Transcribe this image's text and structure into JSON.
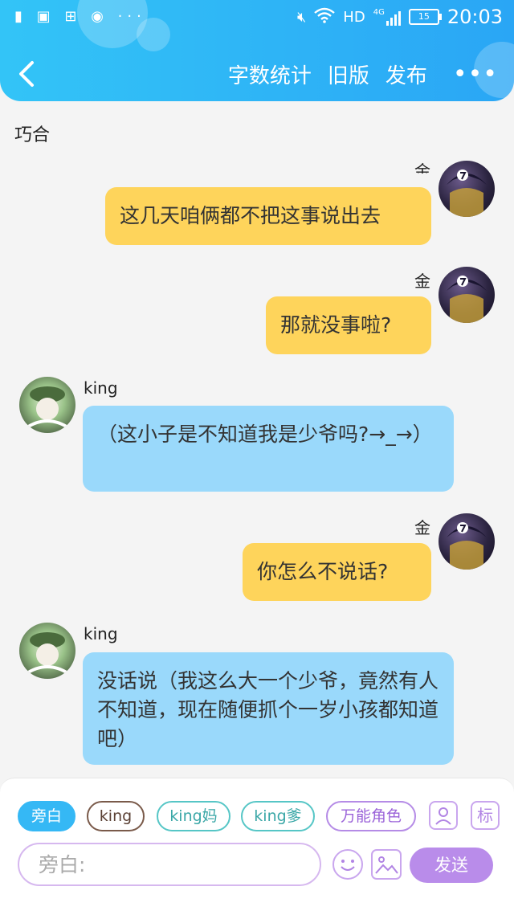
{
  "status_bar": {
    "left_icons": [
      "sim-icon",
      "image-icon",
      "apps-icon",
      "record-icon",
      "more-dots"
    ],
    "signal": "HD",
    "network": "4G",
    "battery": "15",
    "time": "20:03"
  },
  "header": {
    "word_count": "字数统计",
    "old_version": "旧版",
    "publish": "发布",
    "more": "•••"
  },
  "chat": {
    "title": "巧合",
    "messages": [
      {
        "sender": "金",
        "side": "right",
        "text": "这几天咱俩都不把这事说出去"
      },
      {
        "sender": "金",
        "side": "right",
        "text": "那就没事啦?"
      },
      {
        "sender": "king",
        "side": "left",
        "text": "（这小子是不知道我是少爷吗?→_→）"
      },
      {
        "sender": "金",
        "side": "right",
        "text": "你怎么不说话?"
      },
      {
        "sender": "king",
        "side": "left",
        "text": "没话说（我这么大一个少爷，竟然有人不知道，现在随便抓个一岁小孩都知道吧）"
      }
    ]
  },
  "roles": [
    "旁白",
    "king",
    "king妈",
    "king爹",
    "万能角色"
  ],
  "tag_icon_label": "标",
  "input": {
    "placeholder": "旁白:"
  },
  "send_label": "发送",
  "colors": {
    "header": "#2aa6f5",
    "yellow_bubble": "#fed45b",
    "blue_bubble": "#9ad9fb",
    "accent_purple": "#b98cea"
  }
}
